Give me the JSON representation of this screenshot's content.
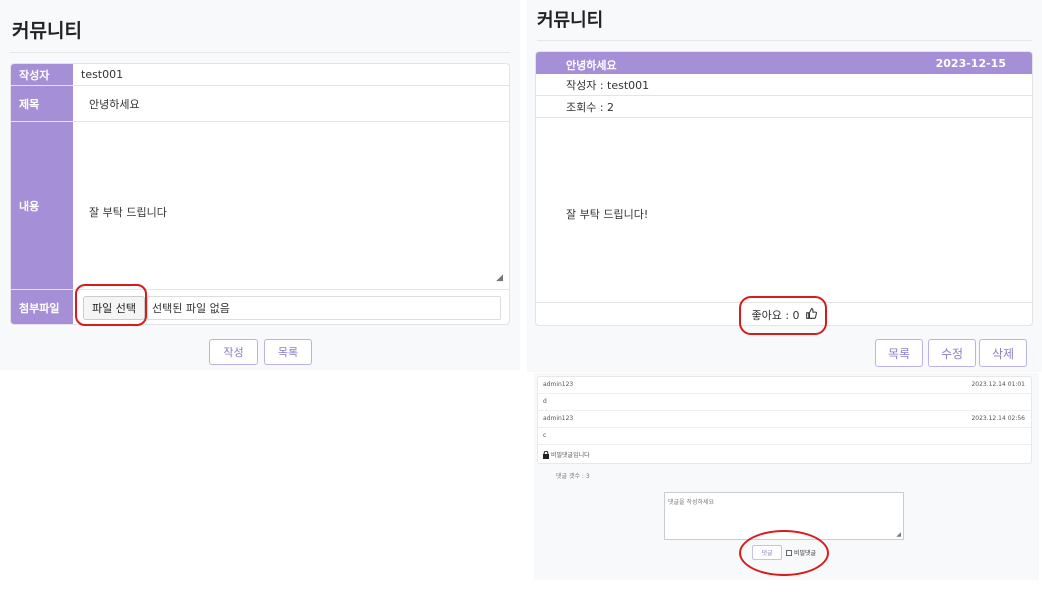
{
  "write_form": {
    "page_title": "커뮤니티",
    "labels": {
      "author": "작성자",
      "title": "제목",
      "content": "내용",
      "attachment": "첨부파일"
    },
    "values": {
      "author": "test001",
      "title": "안녕하세요",
      "content": "잘 부탁 드립니다"
    },
    "file_button": "파일 선택",
    "file_status": "선택된 파일 없음",
    "buttons": {
      "write": "작성",
      "list": "목록"
    }
  },
  "detail": {
    "page_title": "커뮤니티",
    "post_title": "안녕하세요",
    "post_date": "2023-12-15",
    "author_line": "작성자 : test001",
    "views_line": "조회수 : 2",
    "body": "잘 부탁 드립니다!",
    "likes_line": "좋아요 : 0",
    "like_icon": "thumbs-up-icon",
    "buttons": {
      "list": "목록",
      "edit": "수정",
      "delete": "삭제"
    }
  },
  "comments": {
    "items": [
      {
        "author": "admin123",
        "date": "2023.12.14 01:01",
        "text": "d"
      },
      {
        "author": "admin123",
        "date": "2023.12.14 02:56",
        "text": "c"
      }
    ],
    "secret_notice": "비밀댓글입니다",
    "lock_icon": "lock-icon",
    "count_text": "댓글 갯수 : 3",
    "placeholder": "댓글을 작성하세요",
    "submit_button": "댓글",
    "secret_checkbox_label": "비밀댓글"
  },
  "colors": {
    "accent": "#a58fd6",
    "highlight_circle": "#d81b1b"
  }
}
